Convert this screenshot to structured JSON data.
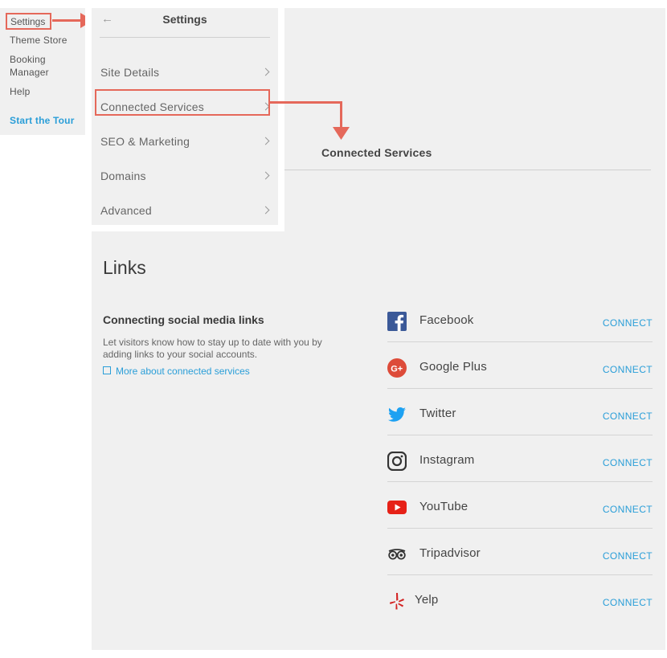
{
  "left_nav": {
    "items": [
      "Settings",
      "Theme Store",
      "Booking\nManager",
      "Help"
    ],
    "tour": "Start the Tour"
  },
  "settings_panel": {
    "title": "Settings",
    "items": [
      {
        "label": "Site Details"
      },
      {
        "label": "Connected Services"
      },
      {
        "label": "SEO & Marketing"
      },
      {
        "label": "Domains"
      },
      {
        "label": "Advanced"
      }
    ]
  },
  "main": {
    "header": "Connected Services",
    "links_title": "Links",
    "section_heading": "Connecting social media links",
    "section_desc": "Let visitors know how to stay up to date with you by adding links to your social accounts.",
    "more_link": "More about connected services",
    "services": [
      {
        "name": "Facebook",
        "action": "CONNECT",
        "icon": "facebook-icon",
        "color": "#3b5998"
      },
      {
        "name": "Google Plus",
        "action": "CONNECT",
        "icon": "google-plus-icon",
        "color": "#dd4b39"
      },
      {
        "name": "Twitter",
        "action": "CONNECT",
        "icon": "twitter-icon",
        "color": "#1da1f2"
      },
      {
        "name": "Instagram",
        "action": "CONNECT",
        "icon": "instagram-icon",
        "color": "#333333"
      },
      {
        "name": "YouTube",
        "action": "CONNECT",
        "icon": "youtube-icon",
        "color": "#e62117"
      },
      {
        "name": "Tripadvisor",
        "action": "CONNECT",
        "icon": "tripadvisor-icon",
        "color": "#333333"
      },
      {
        "name": "Yelp",
        "action": "CONNECT",
        "icon": "yelp-icon",
        "color": "#d32323"
      }
    ]
  },
  "colors": {
    "accent": "#2a9ed8",
    "highlight": "#e5685a",
    "panel_bg": "#f0f0f0"
  }
}
